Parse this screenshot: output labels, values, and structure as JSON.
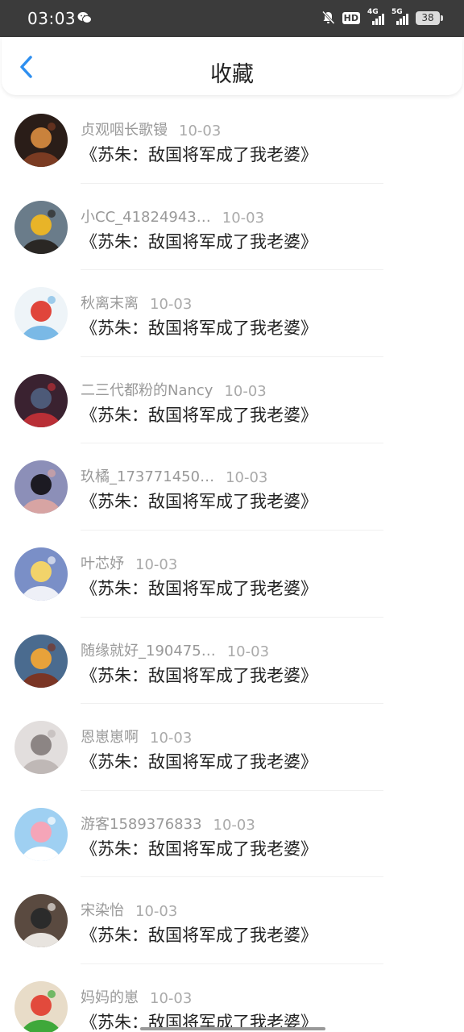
{
  "status_bar": {
    "time": "03:03",
    "hd_label": "HD",
    "net_4g": "4G",
    "net_5g": "5G",
    "battery": "38"
  },
  "nav": {
    "title": "收藏"
  },
  "items": [
    {
      "user": "贞观咽长歌镘",
      "date": "10-03",
      "title": "《苏朱：敌国将军成了我老婆》",
      "avatar_colors": [
        "#2a1d18",
        "#7a3b22",
        "#c9823c"
      ]
    },
    {
      "user": "小CC_41824943…",
      "date": "10-03",
      "title": "《苏朱：敌国将军成了我老婆》",
      "avatar_colors": [
        "#6a7c8a",
        "#2a2724",
        "#e8b428"
      ]
    },
    {
      "user": "秋离末离",
      "date": "10-03",
      "title": "《苏朱：敌国将军成了我老婆》",
      "avatar_colors": [
        "#eef4f8",
        "#7ab9e6",
        "#e0453b"
      ]
    },
    {
      "user": "二三代都粉的Nancy",
      "date": "10-03",
      "title": "《苏朱：敌国将军成了我老婆》",
      "avatar_colors": [
        "#3a2230",
        "#b92f36",
        "#4d5a78"
      ]
    },
    {
      "user": "玖橘_173771450…",
      "date": "10-03",
      "title": "《苏朱：敌国将军成了我老婆》",
      "avatar_colors": [
        "#8c8fb8",
        "#d7a4a3",
        "#1c1a22"
      ]
    },
    {
      "user": "叶芯妤",
      "date": "10-03",
      "title": "《苏朱：敌国将军成了我老婆》",
      "avatar_colors": [
        "#7a8fc7",
        "#eef0f7",
        "#f2d36a"
      ]
    },
    {
      "user": "随缘就好_190475…",
      "date": "10-03",
      "title": "《苏朱：敌国将军成了我老婆》",
      "avatar_colors": [
        "#4a6b8f",
        "#7a3525",
        "#e8a23a"
      ]
    },
    {
      "user": "恩崽崽啊",
      "date": "10-03",
      "title": "《苏朱：敌国将军成了我老婆》",
      "avatar_colors": [
        "#e2dedd",
        "#bfb8b6",
        "#8c8584"
      ]
    },
    {
      "user": "游客1589376833",
      "date": "10-03",
      "title": "《苏朱：敌国将军成了我老婆》",
      "avatar_colors": [
        "#9fd0f2",
        "#ffffff",
        "#f5a5b8"
      ]
    },
    {
      "user": "宋染怡",
      "date": "10-03",
      "title": "《苏朱：敌国将军成了我老婆》",
      "avatar_colors": [
        "#5a4a40",
        "#e8e4df",
        "#2b2b2b"
      ]
    },
    {
      "user": "妈妈的崽",
      "date": "10-03",
      "title": "《苏朱：敌国将军成了我老婆》",
      "avatar_colors": [
        "#e8dcc8",
        "#3fa83a",
        "#e24a3c"
      ]
    }
  ],
  "colors": {
    "accent": "#2e8ff0",
    "status_bar_bg": "#3b3b3b",
    "meta_text": "#999999"
  },
  "icons": {
    "back": "chevron-left-icon",
    "wechat": "wechat-icon",
    "mute": "bell-off-icon",
    "battery": "battery-icon"
  }
}
